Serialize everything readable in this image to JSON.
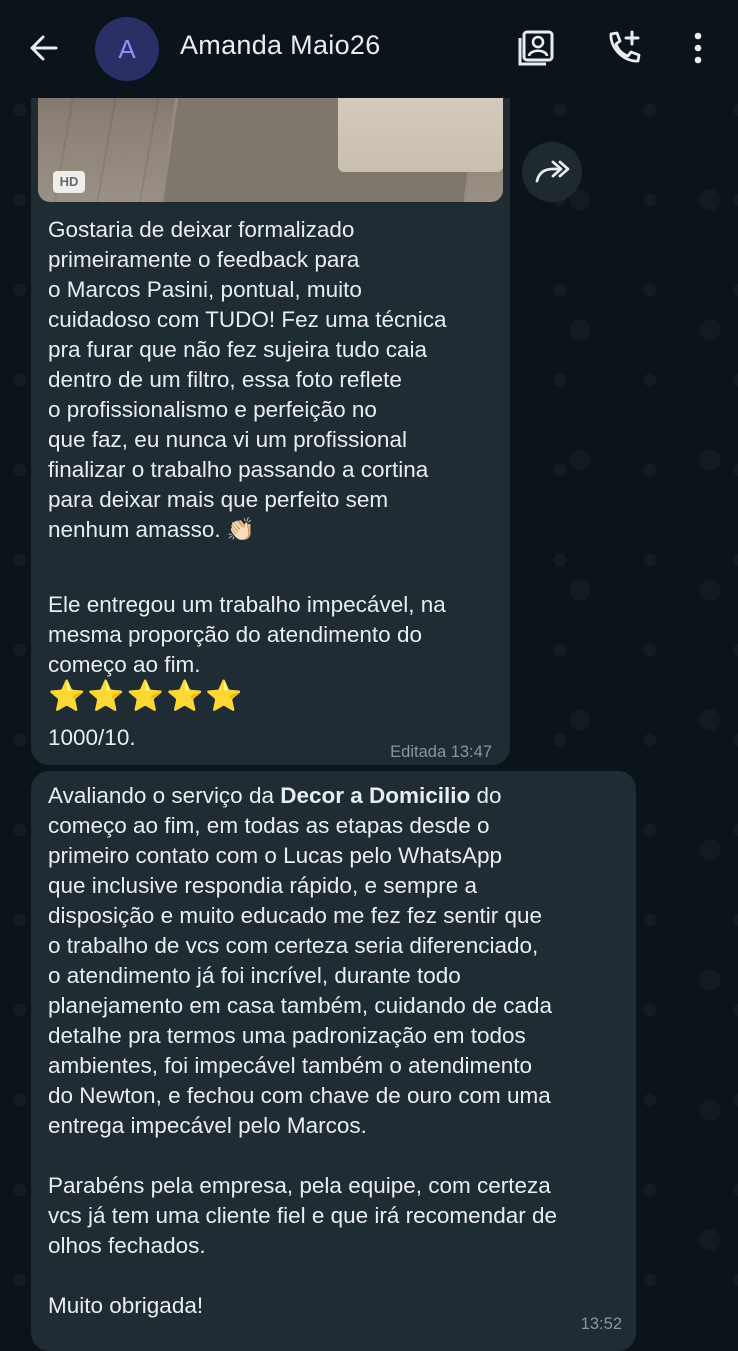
{
  "header": {
    "avatar_initial": "A",
    "contact_name": "Amanda Maio26",
    "icons": [
      "back-arrow-icon",
      "contact-card-icon",
      "add-call-icon",
      "more-vert-icon"
    ]
  },
  "message1": {
    "media_badge": "HD",
    "paragraph1": "Gostaria de deixar formalizado\nprimeiramente o feedback para\no Marcos Pasini, pontual, muito\ncuidadoso com TUDO! Fez uma técnica\npra furar que não fez sujeira tudo caia\ndentro de um filtro, essa foto reflete\no profissionalismo e perfeição no\nque faz, eu nunca vi um profissional\nfinalizar o trabalho passando a cortina\npara deixar mais que perfeito sem\nnenhum amasso. 👏🏻",
    "paragraph2": "Ele entregou um trabalho impecável, na\nmesma proporção do atendimento do\ncomeço ao fim.",
    "stars": "⭐⭐⭐⭐⭐",
    "rating": "1000/10.",
    "status": "Editada 13:47"
  },
  "message2": {
    "line1_prefix": "Avaliando o serviço da ",
    "line1_bold": "Decor a Domicilio",
    "line1_suffix": " do",
    "body": "começo ao fim, em todas as etapas desde o\nprimeiro contato com o Lucas pelo WhatsApp\nque inclusive respondia rápido, e sempre a\ndisposição e muito educado me fez fez sentir que\no trabalho de vcs com certeza seria diferenciado,\no atendimento já foi incrível, durante todo\nplanejamento em casa também, cuidando de cada\ndetalhe pra termos uma padronização em todos\nambientes, foi impecável também o atendimento\ndo Newton, e fechou com chave de ouro com uma\nentrega impecável pelo Marcos.\n\nParabéns pela empresa, pela equipe, com certeza\nvcs já tem uma cliente fiel e que irá recomendar de\nolhos fechados.\n\nMuito obrigada!",
    "time": "13:52"
  },
  "colors": {
    "background": "#0b141a",
    "bubble": "#202c33",
    "meta_text": "#8696a0",
    "text": "#e9edef"
  }
}
